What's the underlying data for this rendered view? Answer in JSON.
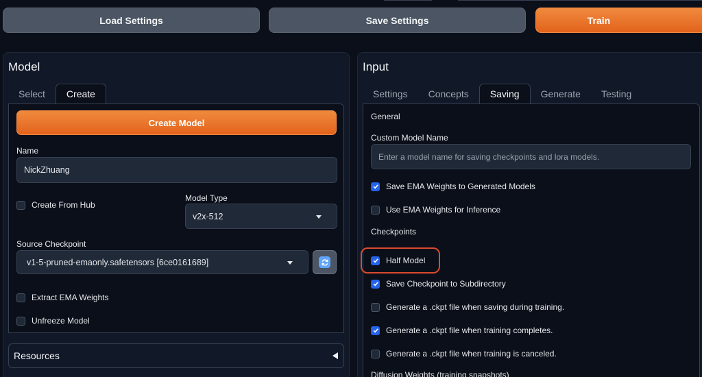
{
  "toolbar": {
    "load_label": "Load Settings",
    "save_label": "Save Settings",
    "train_label": "Train"
  },
  "model_panel": {
    "title": "Model",
    "tabs": [
      "Select",
      "Create"
    ],
    "active_tab": "Create",
    "create_button": "Create Model",
    "name_label": "Name",
    "name_value": "NickZhuang",
    "create_from_hub_label": "Create From Hub",
    "create_from_hub_checked": false,
    "model_type_label": "Model Type",
    "model_type_value": "v2x-512",
    "source_checkpoint_label": "Source Checkpoint",
    "source_checkpoint_value": "v1-5-pruned-emaonly.safetensors [6ce0161689]",
    "extract_ema_label": "Extract EMA Weights",
    "extract_ema_checked": false,
    "unfreeze_label": "Unfreeze Model",
    "unfreeze_checked": false,
    "resources_label": "Resources"
  },
  "input_panel": {
    "title": "Input",
    "tabs": [
      "Settings",
      "Concepts",
      "Saving",
      "Generate",
      "Testing"
    ],
    "active_tab": "Saving",
    "general_label": "General",
    "custom_name_label": "Custom Model Name",
    "custom_name_placeholder": "Enter a model name for saving checkpoints and lora models.",
    "checkboxes": [
      {
        "label": "Save EMA Weights to Generated Models",
        "checked": true
      },
      {
        "label": "Use EMA Weights for Inference",
        "checked": false
      }
    ],
    "checkpoints_label": "Checkpoints",
    "checkpoint_options": [
      {
        "label": "Half Model",
        "checked": true
      },
      {
        "label": "Save Checkpoint to Subdirectory",
        "checked": true
      },
      {
        "label": "Generate a .ckpt file when saving during training.",
        "checked": false
      },
      {
        "label": "Generate a .ckpt file when training completes.",
        "checked": true
      },
      {
        "label": "Generate a .ckpt file when training is canceled.",
        "checked": false
      }
    ],
    "diffusion_label": "Diffusion Weights (training snapshots)"
  },
  "colors": {
    "accent": "#e2631c",
    "checkbox": "#2563eb",
    "highlight": "#dc4a2f"
  }
}
